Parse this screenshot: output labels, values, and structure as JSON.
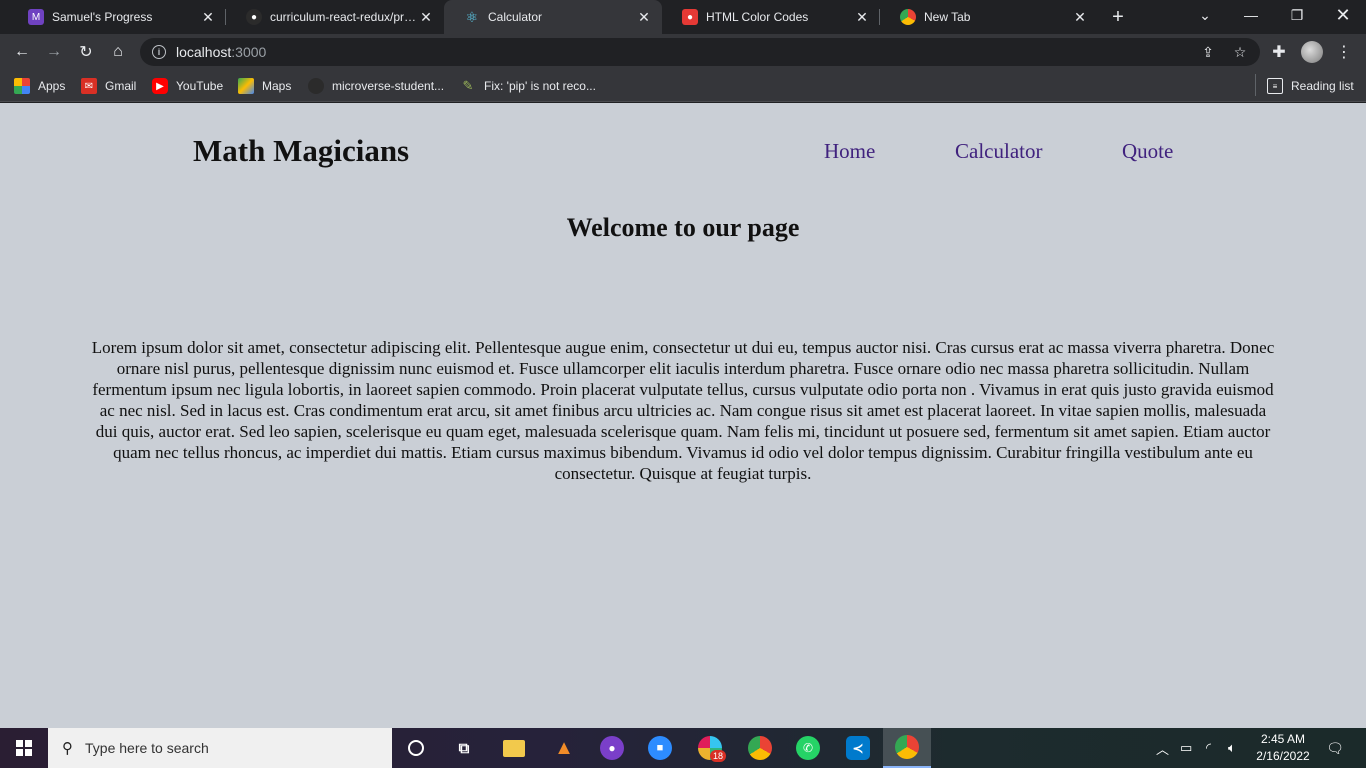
{
  "browser": {
    "tabs": [
      {
        "title": "Samuel's Progress",
        "icon": "microverse-icon",
        "color": "#6f42c1"
      },
      {
        "title": "curriculum-react-redux/proje",
        "icon": "github-icon",
        "color": "#24292e"
      },
      {
        "title": "Calculator",
        "icon": "react-icon",
        "color": "#61dafb"
      },
      {
        "title": "HTML Color Codes",
        "icon": "html-color-icon",
        "color": "#e53935"
      },
      {
        "title": "New Tab",
        "icon": "chrome-icon",
        "color": "#4285f4"
      }
    ],
    "address": {
      "host": "localhost",
      "port": ":3000"
    },
    "bookmarks": [
      {
        "label": "Apps",
        "icon": "apps-grid-icon"
      },
      {
        "label": "Gmail",
        "icon": "gmail-icon"
      },
      {
        "label": "YouTube",
        "icon": "youtube-icon"
      },
      {
        "label": "Maps",
        "icon": "maps-icon"
      },
      {
        "label": "microverse-student...",
        "icon": "github-icon"
      },
      {
        "label": "Fix: 'pip' is not reco...",
        "icon": "python-icon"
      }
    ],
    "reading_list": "Reading list"
  },
  "page": {
    "brand": "Math Magicians",
    "nav": [
      "Home",
      "Calculator",
      "Quote"
    ],
    "heading": "Welcome to our page",
    "body": "Lorem ipsum dolor sit amet, consectetur adipiscing elit. Pellentesque augue enim, consectetur ut dui eu, tempus auctor nisi. Cras cursus erat ac massa viverra pharetra. Donec ornare nisl purus, pellentesque dignissim nunc euismod et. Fusce ullamcorper elit iaculis interdum pharetra. Fusce ornare odio nec massa pharetra sollicitudin. Nullam fermentum ipsum nec ligula lobortis, in laoreet sapien commodo. Proin placerat vulputate tellus, cursus vulputate odio porta non . Vivamus in erat quis justo gravida euismod ac nec nisl. Sed in lacus est. Cras condimentum erat arcu, sit amet finibus arcu ultricies ac. Nam congue risus sit amet est placerat laoreet. In vitae sapien mollis, malesuada dui quis, auctor erat. Sed leo sapien, scelerisque eu quam eget, malesuada scelerisque quam. Nam felis mi, tincidunt ut posuere sed, fermentum sit amet sapien. Etiam auctor quam nec tellus rhoncus, ac imperdiet dui mattis. Etiam cursus maximus bibendum. Vivamus id odio vel dolor tempus dignissim. Curabitur fringilla vestibulum ante eu consectetur. Quisque at feugiat turpis."
  },
  "taskbar": {
    "search_placeholder": "Type here to search",
    "slack_badge": "18",
    "time": "2:45 AM",
    "date": "2/16/2022"
  }
}
